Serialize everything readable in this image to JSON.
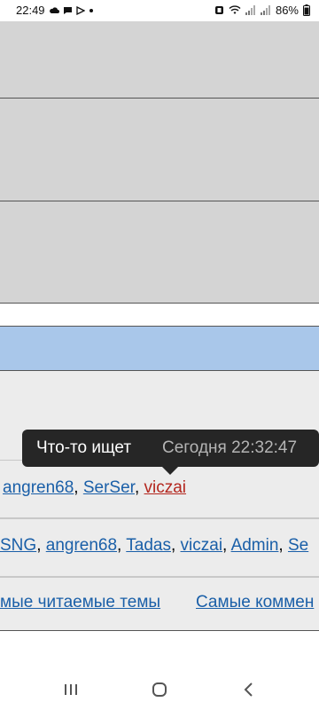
{
  "status_bar": {
    "time": "22:49",
    "battery": "86%"
  },
  "tooltip": {
    "title": "Что-то ищет",
    "time": "Сегодня 22:32:47"
  },
  "users_row_1": {
    "items": [
      "angren68",
      "SerSer",
      "viczai"
    ],
    "sep": ", "
  },
  "users_row_2": {
    "items": [
      "SNG",
      "angren68",
      "Tadas",
      "viczai",
      "Admin",
      "Se"
    ],
    "sep": ", "
  },
  "topics_row": {
    "link1": "мые читаемые темы",
    "link2": "Самые коммен"
  }
}
